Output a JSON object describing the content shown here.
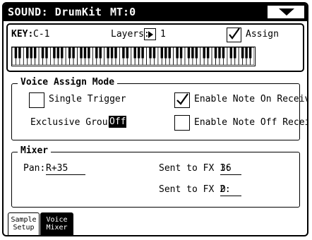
{
  "titlebar": {
    "title": "SOUND: DrumKit",
    "mt": "MT:0",
    "menu_icon": "triangle-down-icon"
  },
  "key_section": {
    "key_label": "KEY:",
    "key_value": "C-1",
    "layers_label": "Layers:",
    "layers_value": "1",
    "assign_label": "Assign",
    "assign_checked": true,
    "keyboard_octaves": 9
  },
  "voice_assign": {
    "title": "Voice Assign Mode",
    "single_trigger_label": "Single Trigger",
    "single_trigger_checked": false,
    "exclusive_group_label": "Exclusive Group:",
    "exclusive_group_value": "Off",
    "note_on_label": "Enable Note On Receive",
    "note_on_checked": true,
    "note_off_label": "Enable Note Off Receive",
    "note_off_checked": false
  },
  "mixer": {
    "title": "Mixer",
    "pan_label": "Pan:",
    "pan_value": "R+35",
    "fx1_label": "Sent to FX 1:",
    "fx1_value": "36",
    "fx2_label": "Sent to FX 2:",
    "fx2_value": "0"
  },
  "tabs": [
    {
      "line1": "Sample",
      "line2": "Setup",
      "active": false
    },
    {
      "line1": "Voice",
      "line2": "Mixer",
      "active": true
    }
  ]
}
